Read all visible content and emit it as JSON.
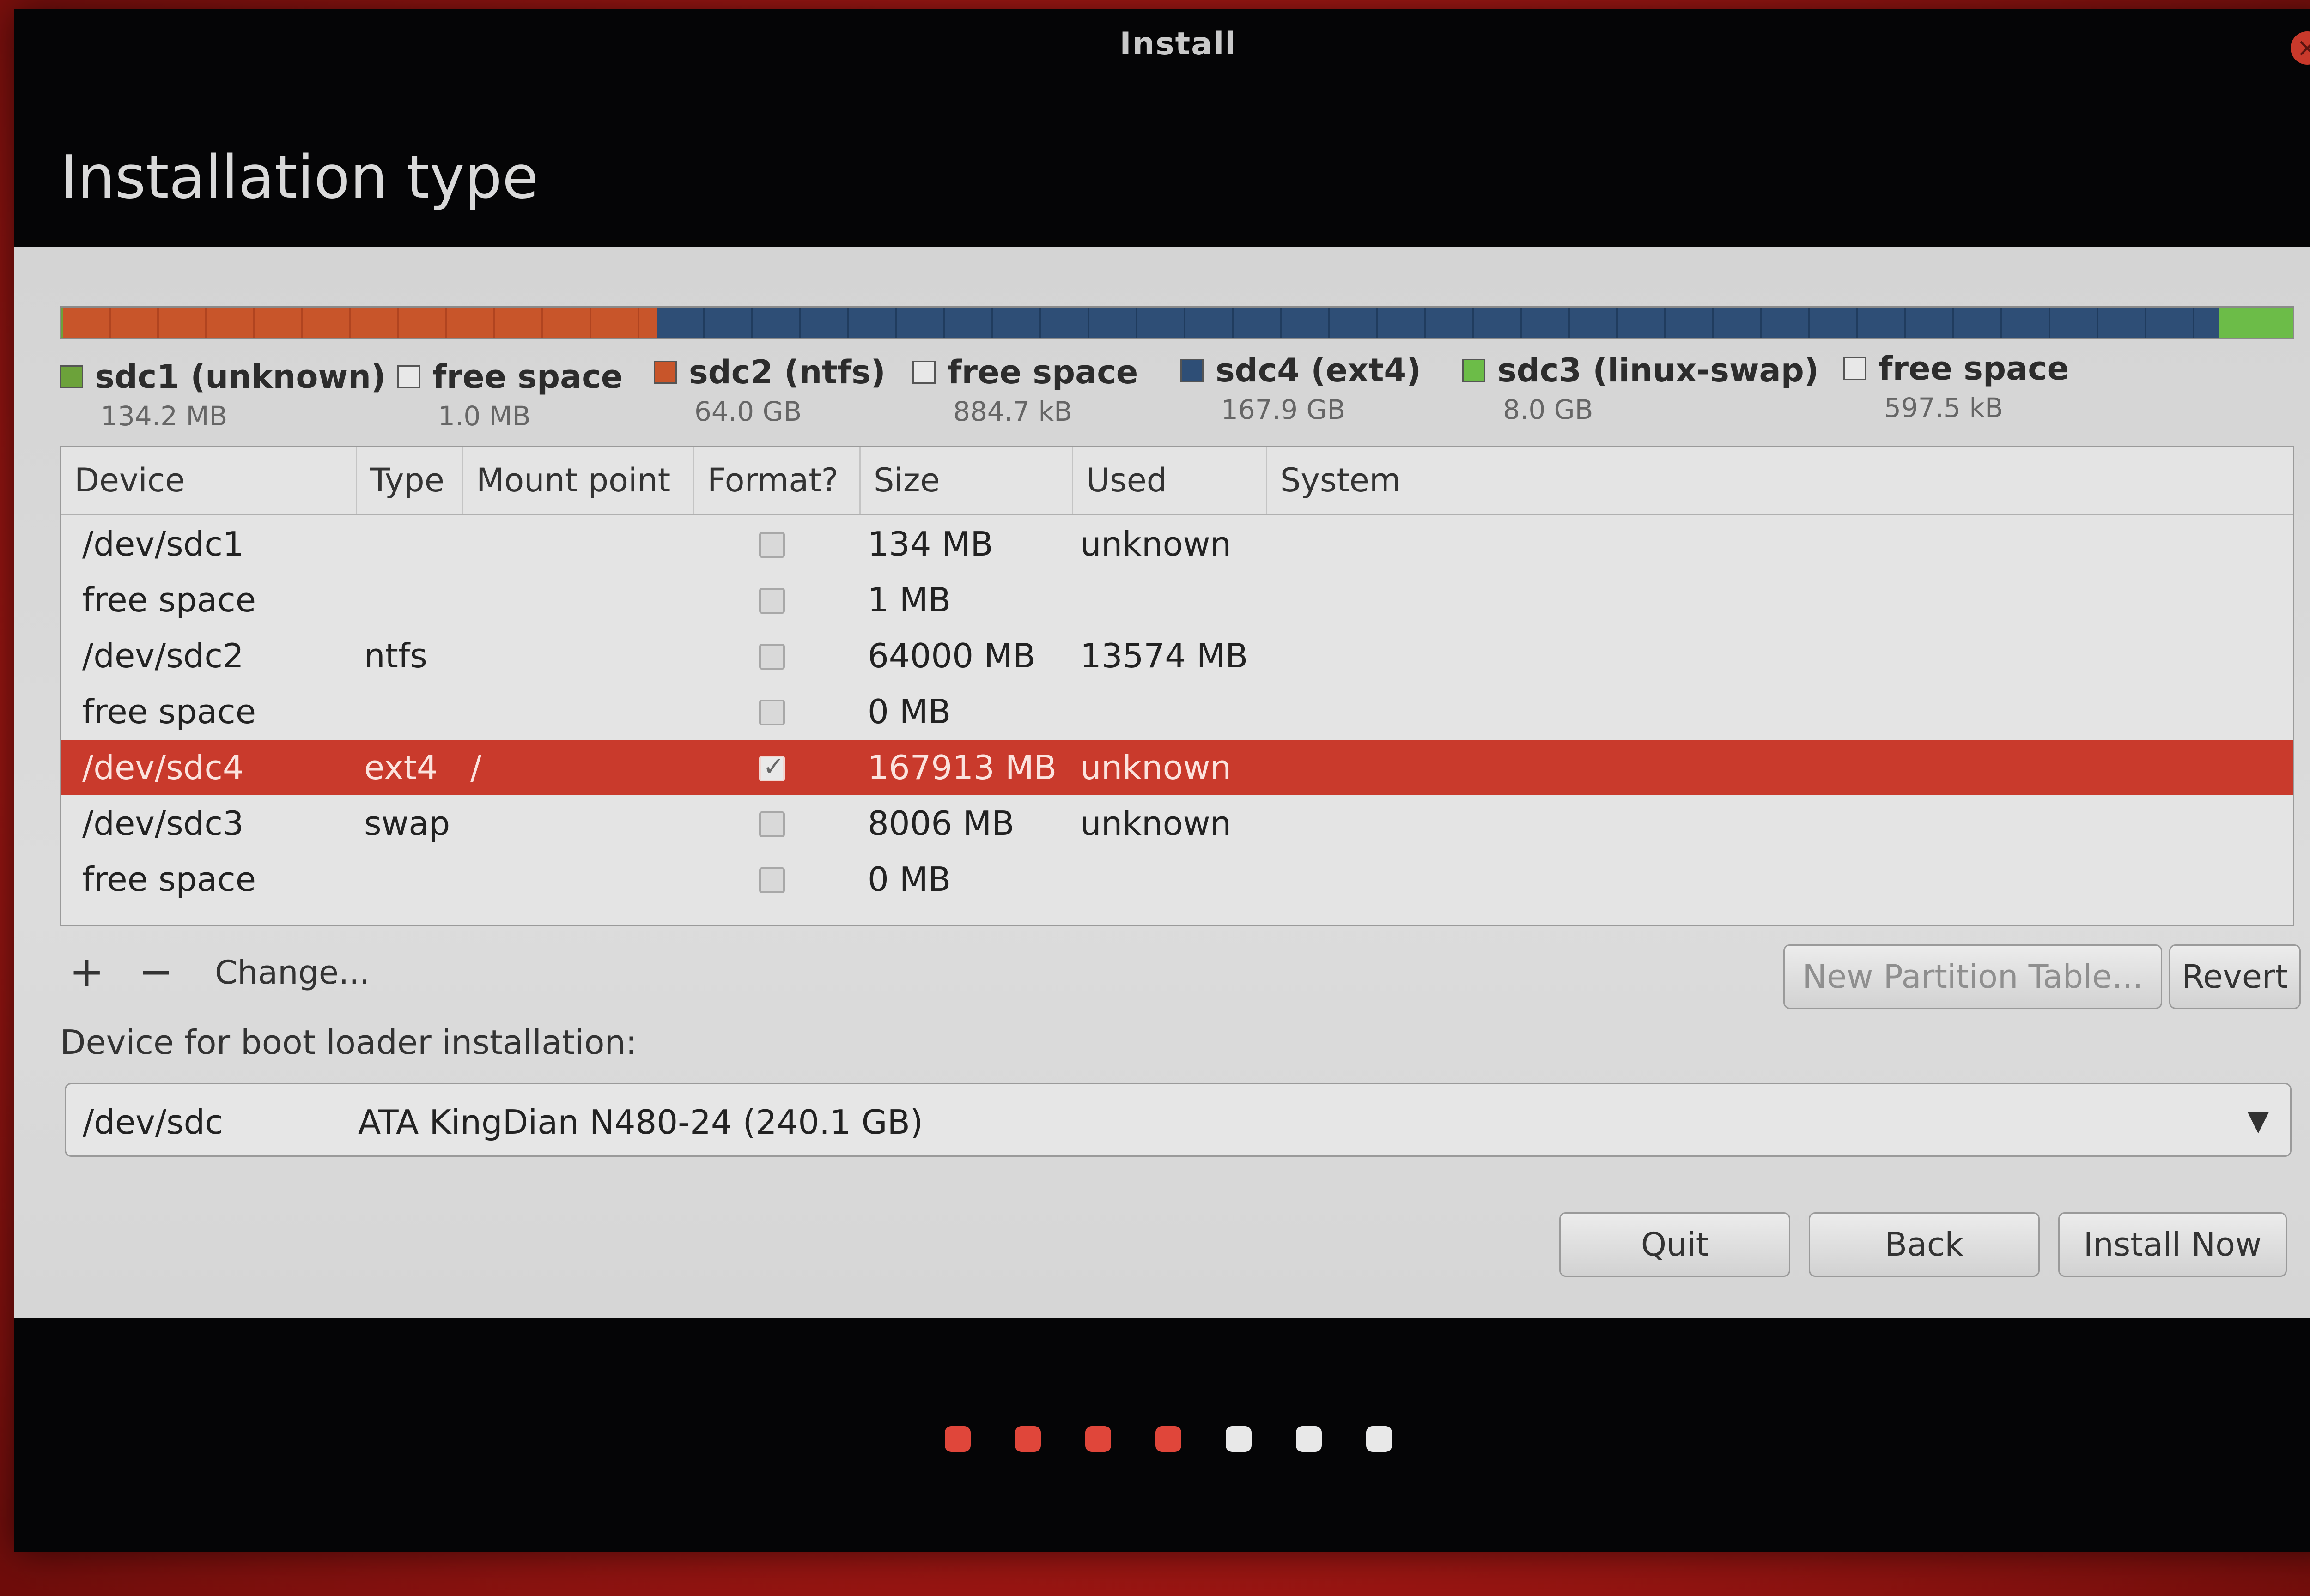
{
  "window": {
    "title": "Install"
  },
  "page": {
    "title": "Installation type"
  },
  "partition_bar": {
    "segments": [
      {
        "name": "sdc1",
        "color": "#6ca23a",
        "fraction": 0.0006
      },
      {
        "name": "sdc2",
        "color": "#c8552a",
        "fraction": 0.266
      },
      {
        "name": "sdc4",
        "color": "#2e4e76",
        "fraction": 0.699
      },
      {
        "name": "sdc3",
        "color": "#6cbc48",
        "fraction": 0.033
      }
    ]
  },
  "legend": [
    {
      "label": "sdc1 (unknown)",
      "size": "134.2 MB",
      "color": "#6ca23a"
    },
    {
      "label": "free space",
      "size": "1.0 MB",
      "color": "#e8e8e8"
    },
    {
      "label": "sdc2 (ntfs)",
      "size": "64.0 GB",
      "color": "#c8552a"
    },
    {
      "label": "free space",
      "size": "884.7 kB",
      "color": "#e8e8e8"
    },
    {
      "label": "sdc4 (ext4)",
      "size": "167.9 GB",
      "color": "#2e4e76"
    },
    {
      "label": "sdc3 (linux-swap)",
      "size": "8.0 GB",
      "color": "#6cbc48"
    },
    {
      "label": "free space",
      "size": "597.5 kB",
      "color": "#e8e8e8"
    }
  ],
  "table": {
    "headers": [
      "Device",
      "Type",
      "Mount point",
      "Format?",
      "Size",
      "Used",
      "System"
    ],
    "rows": [
      {
        "device": "/dev/sdc1",
        "type": "",
        "mount": "",
        "format": false,
        "size": "134 MB",
        "used": "unknown",
        "system": ""
      },
      {
        "device": "free space",
        "type": "",
        "mount": "",
        "format": false,
        "size": "1 MB",
        "used": "",
        "system": ""
      },
      {
        "device": "/dev/sdc2",
        "type": "ntfs",
        "mount": "",
        "format": false,
        "size": "64000 MB",
        "used": "13574 MB",
        "system": ""
      },
      {
        "device": "free space",
        "type": "",
        "mount": "",
        "format": false,
        "size": "0 MB",
        "used": "",
        "system": ""
      },
      {
        "device": "/dev/sdc4",
        "type": "ext4",
        "mount": "/",
        "format": true,
        "size": "167913 MB",
        "used": "unknown",
        "system": "",
        "selected": true
      },
      {
        "device": "/dev/sdc3",
        "type": "swap",
        "mount": "",
        "format": false,
        "size": "8006 MB",
        "used": "unknown",
        "system": ""
      },
      {
        "device": "free space",
        "type": "",
        "mount": "",
        "format": false,
        "size": "0 MB",
        "used": "",
        "system": ""
      }
    ]
  },
  "toolbar": {
    "add_label": "+",
    "remove_label": "−",
    "change_label": "Change...",
    "new_table_label": "New Partition Table...",
    "revert_label": "Revert"
  },
  "bootloader": {
    "label": "Device for boot loader installation:",
    "device": "/dev/sdc",
    "description": "ATA KingDian N480-24 (240.1 GB)"
  },
  "buttons": {
    "quit": "Quit",
    "back": "Back",
    "install": "Install Now"
  },
  "progress": {
    "total_steps": 7,
    "completed_steps": 4,
    "completed_color": "#e0463a",
    "pending_color": "#e8e8e8"
  }
}
